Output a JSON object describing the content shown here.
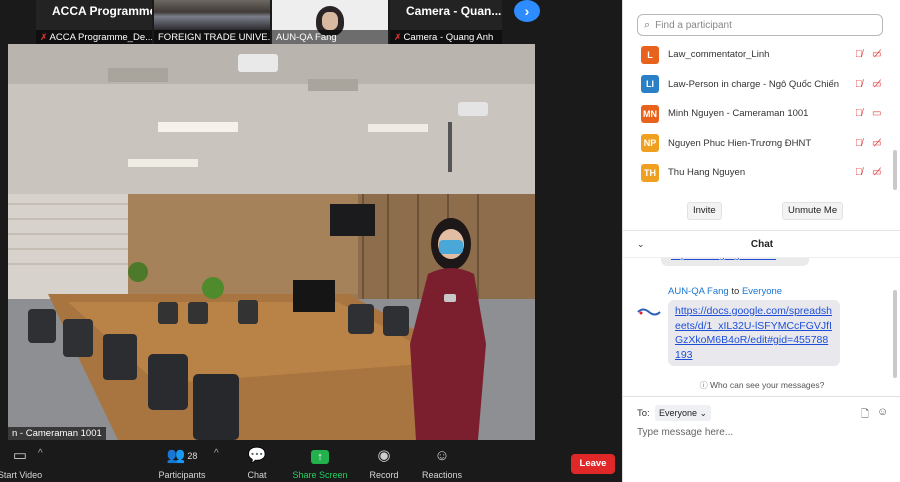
{
  "thumbnails": [
    {
      "title": "ACCA  Programme_D...",
      "label": "ACCA Programme_De..."
    },
    {
      "label": "FOREIGN TRADE UNIVE..."
    },
    {
      "label": "AUN-QA Fang"
    },
    {
      "title": "Camera  - Quan...",
      "label": "Camera  - Quang Anh"
    }
  ],
  "next_icon": "›",
  "main_video": {
    "speaker_label": "n - Cameraman 1001"
  },
  "toolbar": {
    "start_video": "Start Video",
    "participants": "Participants",
    "participants_count": "28",
    "chat": "Chat",
    "share_screen": "Share Screen",
    "record": "Record",
    "reactions": "Reactions",
    "leave": "Leave",
    "caret": "^"
  },
  "participants_panel": {
    "search_placeholder": "Find a participant",
    "participants": [
      {
        "initials": "L",
        "name": "Law_commentator_Linh",
        "color": "#e8621c"
      },
      {
        "initials": "LI",
        "name": "Law-Person in charge - Ngô Quốc Chiến",
        "color": "#2b7fc7"
      },
      {
        "initials": "MN",
        "name": "Minh Nguyen - Cameraman 1001",
        "color": "#e8621c"
      },
      {
        "initials": "NP",
        "name": "Nguyen Phuc Hien-Trương ĐHNT",
        "color": "#f0a020"
      },
      {
        "initials": "TH",
        "name": "Thu Hang Nguyen",
        "color": "#f0a020"
      }
    ],
    "invite": "Invite",
    "unmute_me": "Unmute Me"
  },
  "chat": {
    "title": "Chat",
    "previous_snippet": "https://docs.google.com/...",
    "sender": "AUN-QA Fang",
    "to_word": "to",
    "recipient": "Everyone",
    "message": "https://docs.google.com/spreadsheets/d/1_xIL32U-lSFYMCcFGVJfIGzXkoM6B4oR/edit#gid=455788193",
    "visibility_note": "Who can see your messages?",
    "to_label": "To:",
    "send_to": "Everyone",
    "input_placeholder": "Type message here..."
  },
  "colors": {
    "accent": "#2d8cff",
    "leave": "#e02828",
    "share": "#23b14d",
    "muted": "#e23b3b"
  }
}
